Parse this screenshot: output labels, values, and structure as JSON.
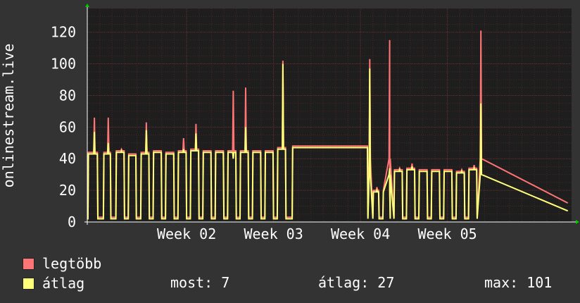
{
  "chart_data": {
    "type": "line",
    "ylabel": "onlinestream.live",
    "ylim": [
      0,
      135
    ],
    "yticks": [
      0,
      20,
      40,
      60,
      80,
      100,
      120
    ],
    "xlim": [
      0,
      39
    ],
    "xticks": [
      {
        "pos": 8,
        "label": "Week 02"
      },
      {
        "pos": 15,
        "label": "Week 03"
      },
      {
        "pos": 22,
        "label": "Week 04"
      },
      {
        "pos": 29,
        "label": "Week 05"
      }
    ],
    "grid": true,
    "legend_position": "bottom-left",
    "colors": {
      "background": "#333333",
      "plot_bg": "#1e1e1e",
      "grid_major": "#6a3030",
      "grid_minor": "#4a2626",
      "axis": "#ffffff",
      "max_line": "#ff7575",
      "avg_line": "#ffff7a"
    },
    "series": [
      {
        "name": "legtöbb",
        "color": "#ff7575"
      },
      {
        "name": "átlag",
        "color": "#ffff7a"
      }
    ],
    "daily": [
      {
        "start": 0.05,
        "end": 0.85,
        "high": 43,
        "low": 3,
        "pmax": 66,
        "pavg": 57
      },
      {
        "start": 1.3,
        "end": 1.9,
        "high": 43,
        "low": 3,
        "pmax": 66,
        "pavg": 50
      },
      {
        "start": 2.3,
        "end": 3.0,
        "high": 44,
        "low": 3,
        "pmax": 46,
        "pavg": 45
      },
      {
        "start": 3.3,
        "end": 3.95,
        "high": 42,
        "low": 3,
        "pmax": 43,
        "pavg": 42
      },
      {
        "start": 4.3,
        "end": 5.0,
        "high": 43,
        "low": 3,
        "pmax": 63,
        "pavg": 58
      },
      {
        "start": 5.3,
        "end": 6.0,
        "high": 44,
        "low": 3,
        "pmax": 45,
        "pavg": 44
      },
      {
        "start": 6.3,
        "end": 7.0,
        "high": 43,
        "low": 3,
        "pmax": 44,
        "pavg": 43
      },
      {
        "start": 7.3,
        "end": 8.0,
        "high": 44,
        "low": 3,
        "pmax": 53,
        "pavg": 46
      },
      {
        "start": 8.3,
        "end": 9.0,
        "high": 45,
        "low": 3,
        "pmax": 62,
        "pavg": 56
      },
      {
        "start": 9.3,
        "end": 10.0,
        "high": 44,
        "low": 3,
        "pmax": 45,
        "pavg": 44
      },
      {
        "start": 10.3,
        "end": 11.0,
        "high": 44,
        "low": 3,
        "pmax": 45,
        "pavg": 44
      },
      {
        "start": 11.3,
        "end": 12.0,
        "high": 44,
        "low": 3,
        "pmax": 83,
        "pavg": 40
      },
      {
        "start": 12.3,
        "end": 13.0,
        "high": 44,
        "low": 3,
        "pmax": 85,
        "pavg": 60
      },
      {
        "start": 13.3,
        "end": 14.0,
        "high": 44,
        "low": 3,
        "pmax": 45,
        "pavg": 44
      },
      {
        "start": 14.3,
        "end": 15.0,
        "high": 44,
        "low": 3,
        "pmax": 45,
        "pavg": 44
      },
      {
        "start": 15.3,
        "end": 16.0,
        "high": 46,
        "low": 3,
        "pmax": 102,
        "pavg": 100
      },
      {
        "start": 23.0,
        "end": 23.5,
        "high": 19,
        "low": 3,
        "pmax": 22,
        "pavg": 20
      },
      {
        "start": 24.7,
        "end": 25.4,
        "high": 32,
        "low": 5,
        "pmax": 34,
        "pavg": 33
      },
      {
        "start": 25.7,
        "end": 26.4,
        "high": 33,
        "low": 5,
        "pmax": 37,
        "pavg": 35
      },
      {
        "start": 26.7,
        "end": 27.4,
        "high": 32,
        "low": 5,
        "pmax": 33,
        "pavg": 32
      },
      {
        "start": 27.7,
        "end": 28.4,
        "high": 32,
        "low": 5,
        "pmax": 33,
        "pavg": 32
      },
      {
        "start": 28.7,
        "end": 29.4,
        "high": 32,
        "low": 5,
        "pmax": 33,
        "pavg": 32
      },
      {
        "start": 29.7,
        "end": 30.4,
        "high": 31,
        "low": 5,
        "pmax": 33,
        "pavg": 32
      },
      {
        "start": 30.7,
        "end": 31.4,
        "high": 33,
        "low": 5,
        "pmax": 36,
        "pavg": 34
      }
    ],
    "plateaus": [
      {
        "start": 16.5,
        "end": 22.6,
        "level": 47,
        "max": 48
      },
      {
        "start": 23.8,
        "end": 24.4,
        "level": 19,
        "max": 20
      }
    ],
    "spikes": [
      {
        "at": 22.75,
        "max": 103,
        "avg": 97
      },
      {
        "at": 24.35,
        "max": 115,
        "avg": 34
      },
      {
        "at": 31.7,
        "max": 121,
        "avg": 75
      }
    ],
    "current": {
      "max": 12,
      "avg": 7
    },
    "legend": {
      "items": [
        {
          "label": "legtöbb",
          "color": "#ff7575"
        },
        {
          "label": "átlag",
          "color": "#ffff7a"
        }
      ],
      "stats": {
        "current": "most: 7",
        "average": "átlag: 27",
        "max": "max: 101"
      }
    }
  }
}
